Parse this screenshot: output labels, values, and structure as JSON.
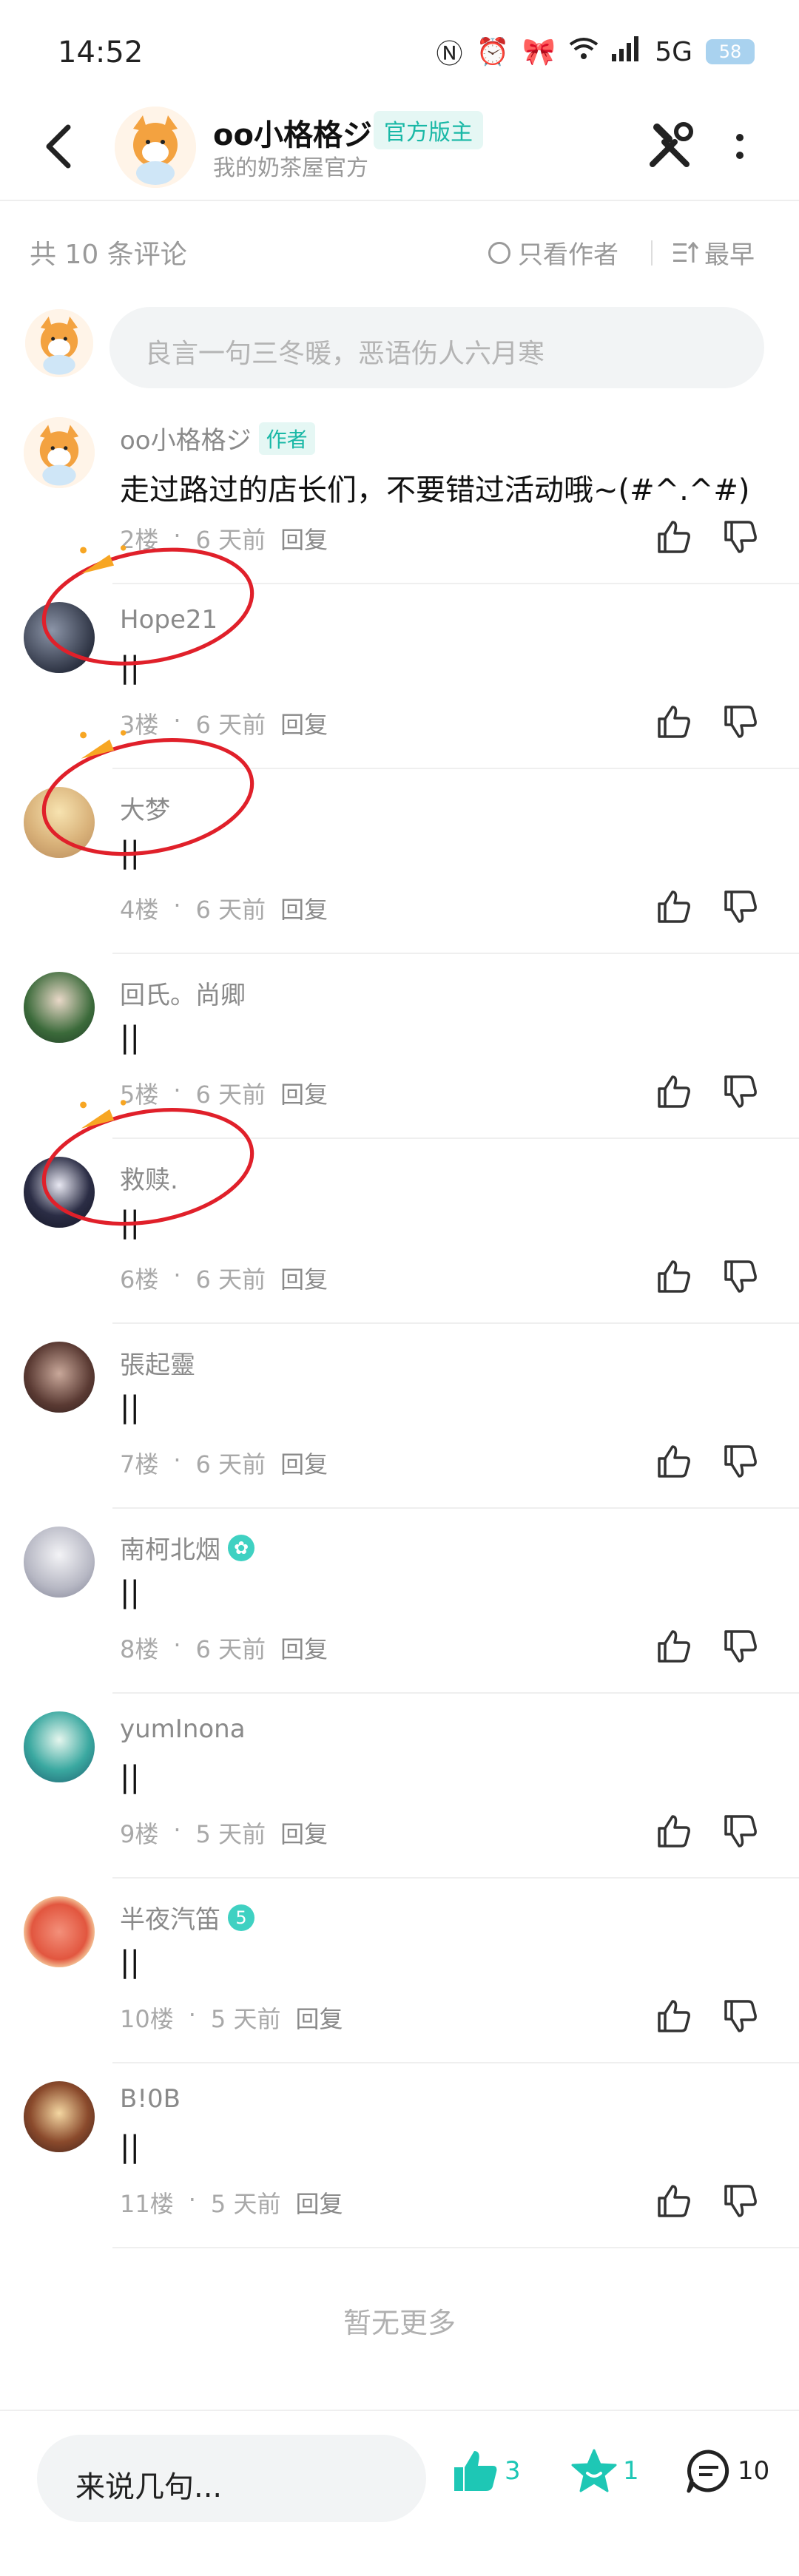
{
  "status": {
    "time": "14:52",
    "network": "5G",
    "battery": "58"
  },
  "header": {
    "name": "oo小格格ジ",
    "badge": "官方版主",
    "subtitle": "我的奶茶屋官方"
  },
  "count_bar": {
    "count_text": "共 10 条评论",
    "only_author": "只看作者",
    "sort": "最早"
  },
  "input": {
    "placeholder": "良言一句三冬暖，恶语伤人六月寒"
  },
  "comments": [
    {
      "name": "oo小格格ジ",
      "tag": "作者",
      "content": "走过路过的店长们，不要错过活动哦~(#^.^#)",
      "floor": "2楼",
      "time": "6 天前",
      "reply": "回复"
    },
    {
      "name": "Hope21",
      "content": "||",
      "floor": "3楼",
      "time": "6 天前",
      "reply": "回复"
    },
    {
      "name": "大梦",
      "content": "||",
      "floor": "4楼",
      "time": "6 天前",
      "reply": "回复"
    },
    {
      "name": "回氏。尚卿",
      "content": "||",
      "floor": "5楼",
      "time": "6 天前",
      "reply": "回复"
    },
    {
      "name": "救赎.",
      "content": "||",
      "floor": "6楼",
      "time": "6 天前",
      "reply": "回复"
    },
    {
      "name": "張起靈",
      "content": "||",
      "floor": "7楼",
      "time": "6 天前",
      "reply": "回复"
    },
    {
      "name": "南柯北烟",
      "vip": "✿",
      "content": "||",
      "floor": "8楼",
      "time": "6 天前",
      "reply": "回复"
    },
    {
      "name": "yumInona",
      "content": "||",
      "floor": "9楼",
      "time": "5 天前",
      "reply": "回复"
    },
    {
      "name": "半夜汽笛",
      "vip": "5",
      "content": "||",
      "floor": "10楼",
      "time": "5 天前",
      "reply": "回复"
    },
    {
      "name": "B!0B",
      "content": "||",
      "floor": "11楼",
      "time": "5 天前",
      "reply": "回复"
    }
  ],
  "no_more": "暂无更多",
  "bottom": {
    "say_placeholder": "来说几句...",
    "likes": "3",
    "favs": "1",
    "comments": "10"
  },
  "colors": {
    "accent": "#1ec7b5",
    "annotation": "#e0202a"
  }
}
